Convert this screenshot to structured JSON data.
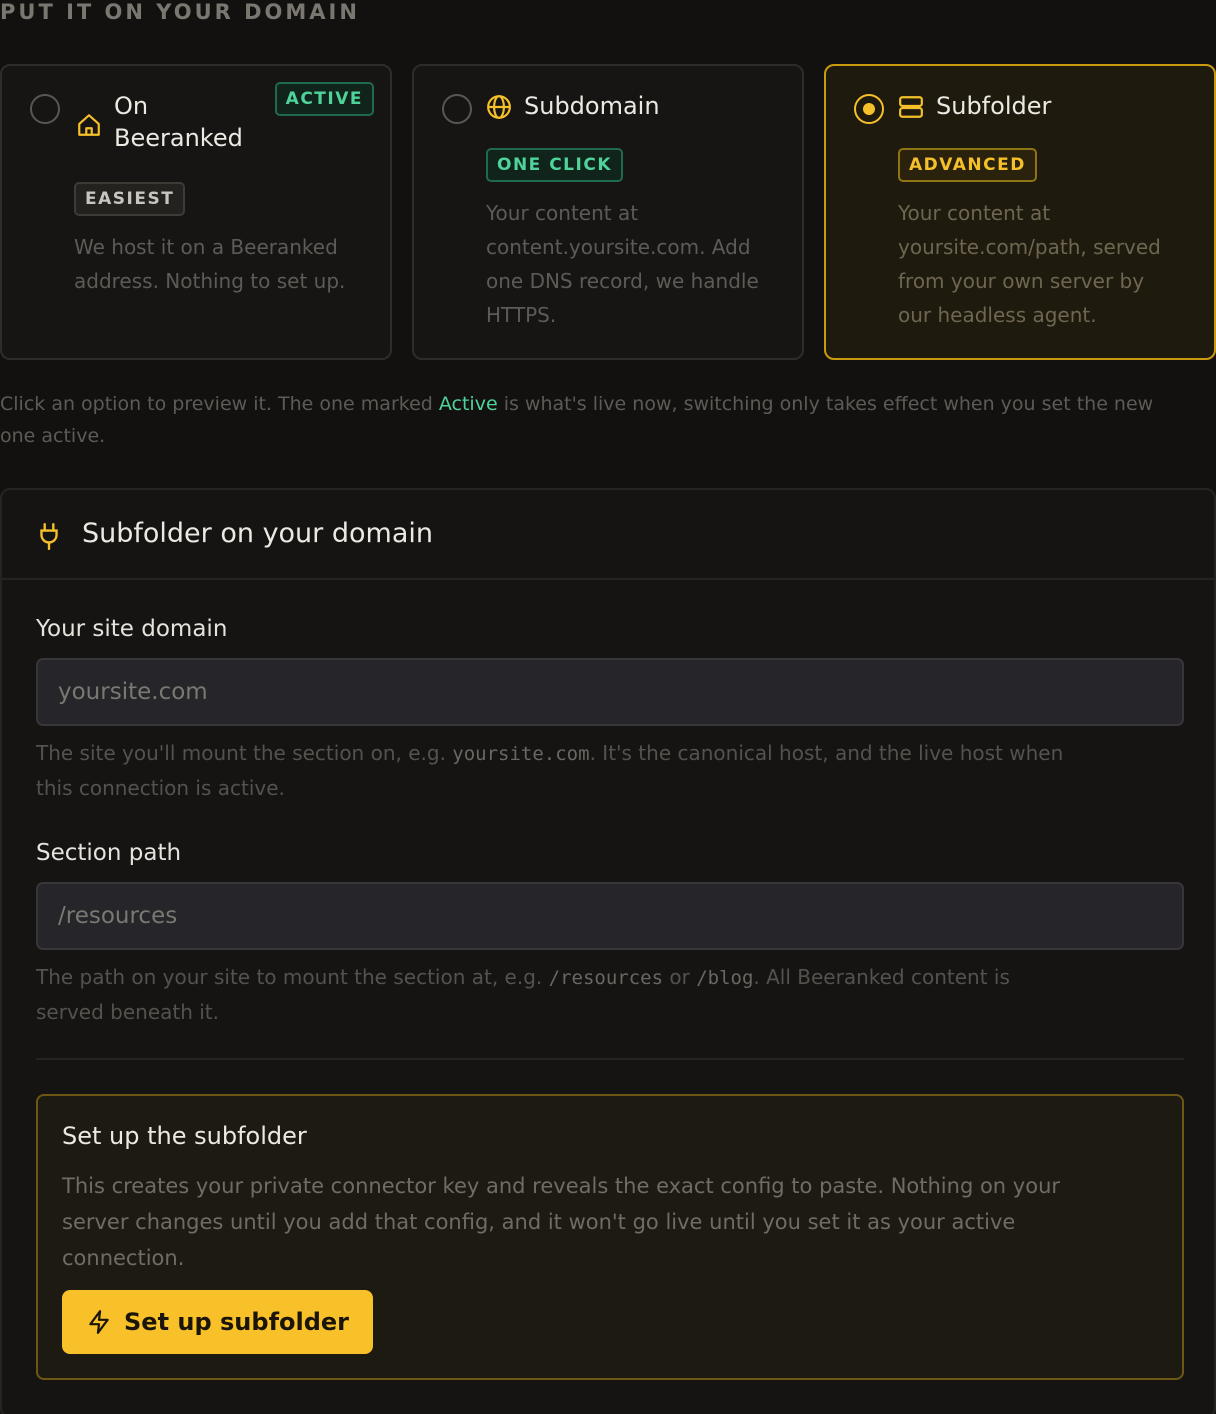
{
  "section_heading": "PUT IT ON YOUR DOMAIN",
  "options": [
    {
      "title_line1": "On",
      "title_line2": "Beeranked",
      "icon": "home-icon",
      "status_badge": "ACTIVE",
      "tag": "EASIEST",
      "description_lines": [
        "We host it on a Beeranked",
        "address. Nothing to set up."
      ],
      "selected": false
    },
    {
      "title": "Subdomain",
      "icon": "globe-icon",
      "tag": "ONE CLICK",
      "description_lines": [
        "Your content at",
        "content.yoursite.com. Add",
        "one DNS record, we handle",
        "HTTPS."
      ],
      "selected": false
    },
    {
      "title": "Subfolder",
      "icon": "server-icon",
      "tag": "ADVANCED",
      "description_lines": [
        "Your content at",
        "yoursite.com/path, served",
        "from your own server by",
        "our headless agent."
      ],
      "selected": true
    }
  ],
  "helper": {
    "before": "Click an option to preview it. The one marked ",
    "highlight": "Active",
    "after_line1": " is what's live now, switching only takes effect when you set the new",
    "line2": "one active."
  },
  "panel": {
    "title": "Subfolder on your domain",
    "icon": "plug-icon",
    "domain_field": {
      "label": "Your site domain",
      "placeholder": "yoursite.com",
      "value": "",
      "help_before": "The site you'll mount the section on, e.g. ",
      "help_code": "yoursite.com",
      "help_after": ". It's the canonical host, and the live host when",
      "help_line2": "this connection is active."
    },
    "path_field": {
      "label": "Section path",
      "placeholder": "/resources",
      "value": "",
      "help_before": "The path on your site to mount the section at, e.g. ",
      "help_code1": "/resources",
      "help_mid": " or ",
      "help_code2": "/blog",
      "help_after": ". All Beeranked content is",
      "help_line2": "served beneath it."
    },
    "setup": {
      "title": "Set up the subfolder",
      "description_lines": [
        "This creates your private connector key and reveals the exact config to paste. Nothing on your",
        "server changes until you add that config, and it won't go live until you set it as your active",
        "connection."
      ],
      "button_label": "Set up subfolder",
      "button_icon": "lightning-icon"
    }
  },
  "colors": {
    "accent": "#f8c12a",
    "success": "#4fd39a",
    "background": "#121110"
  }
}
